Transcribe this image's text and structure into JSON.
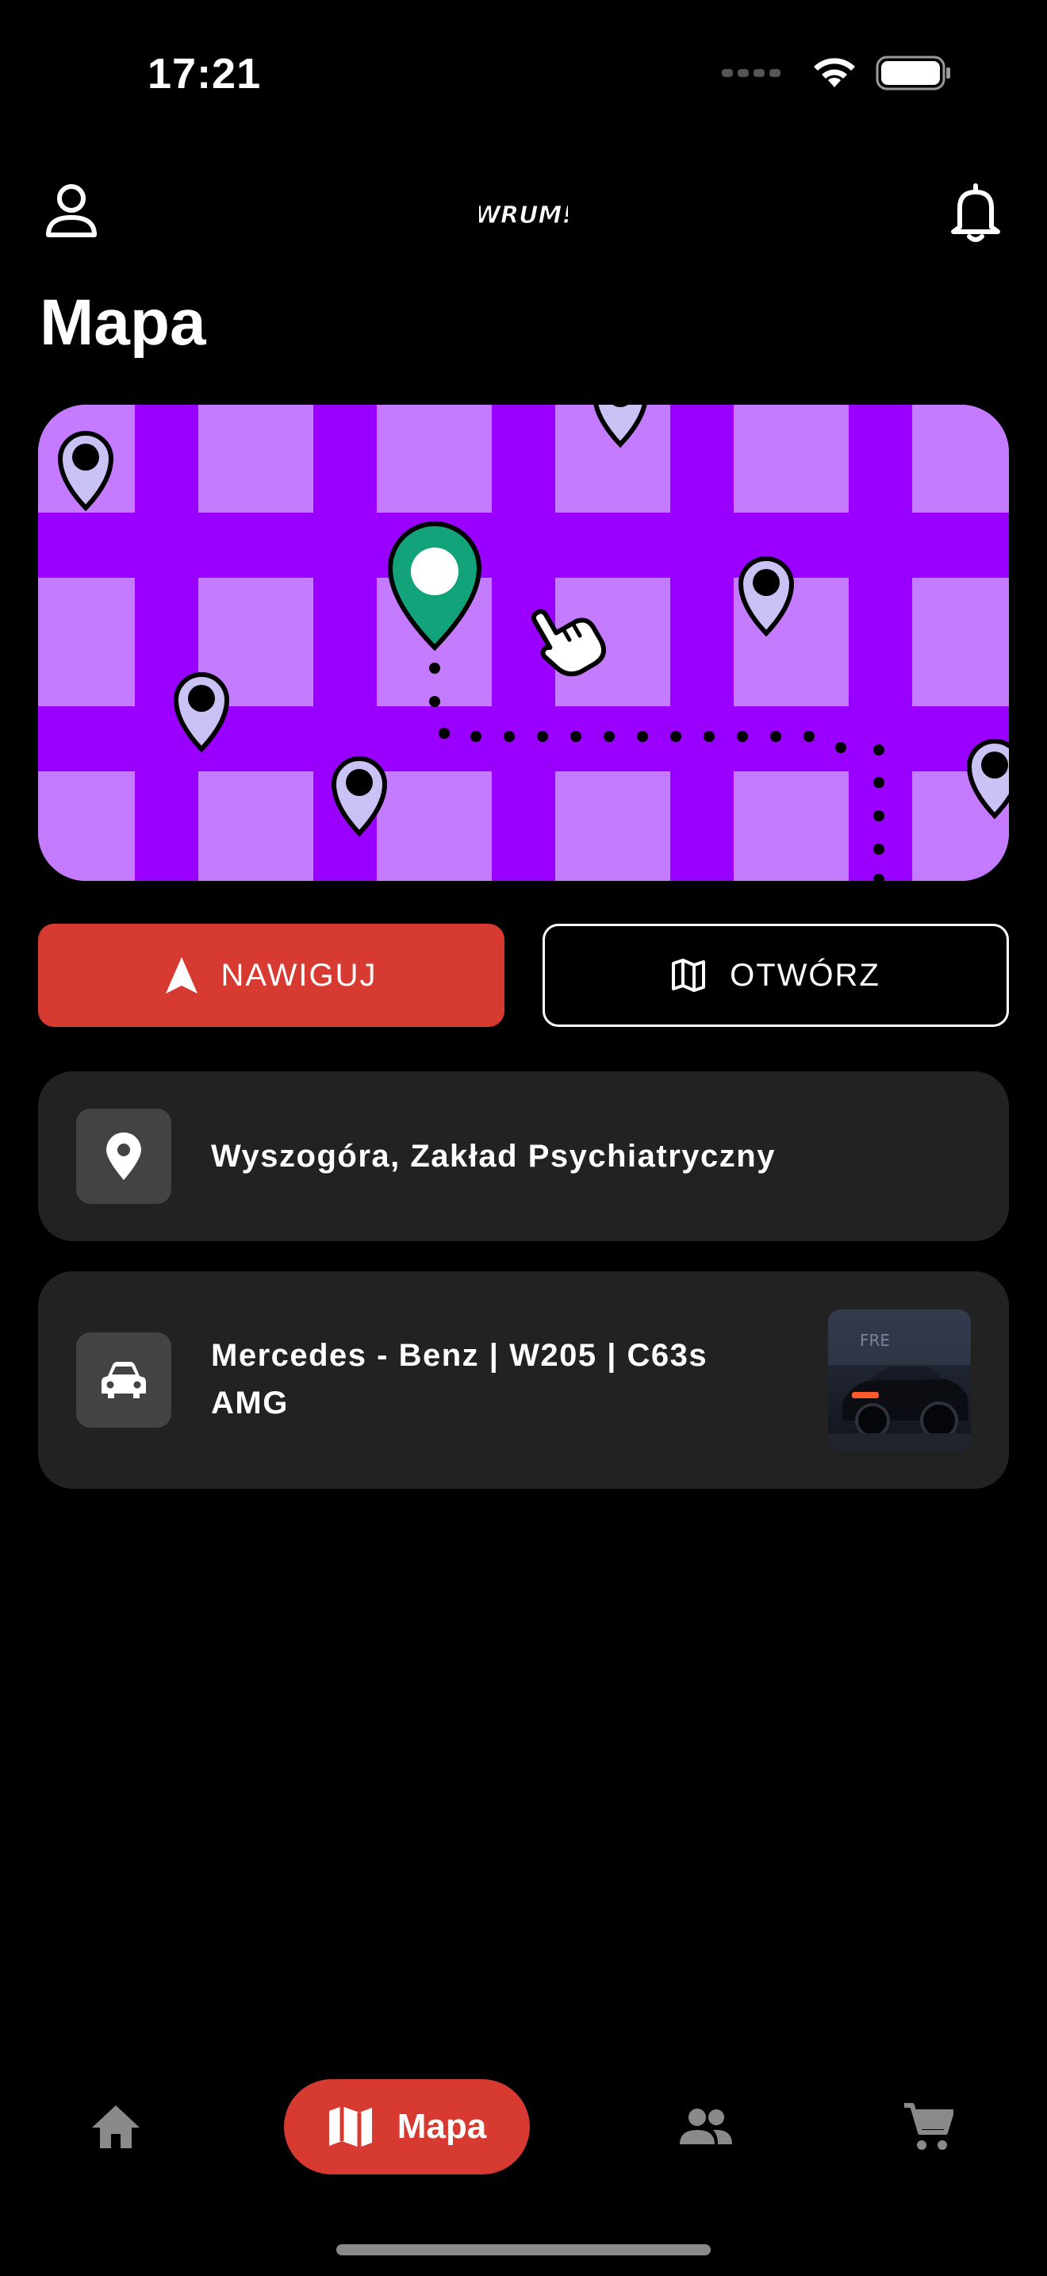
{
  "status_bar": {
    "time": "17:21"
  },
  "header": {
    "profile_icon": "person-outline-icon",
    "notifications_icon": "bell-outline-icon",
    "logo_text": "WRUM!"
  },
  "page": {
    "title": "Mapa"
  },
  "map": {
    "colors": {
      "block": "#c57bff",
      "road": "#9900ff",
      "active_pin": "#12a37a",
      "pin": "#c9c3f5"
    }
  },
  "actions": {
    "navigate_label": "NAWIGUJ",
    "navigate_icon": "navigation-arrow-icon",
    "open_label": "OTWÓRZ",
    "open_icon": "map-outline-icon"
  },
  "location_card": {
    "icon": "location-pin-icon",
    "text": "Wyszogóra, Zakład Psychiatryczny"
  },
  "car_card": {
    "icon": "car-icon",
    "line1": "Mercedes - Benz | W205 | C63s",
    "line2": "AMG"
  },
  "bottom_nav": {
    "items": [
      {
        "icon": "home-icon",
        "label": ""
      },
      {
        "icon": "map-icon",
        "label": "Mapa",
        "active": true
      },
      {
        "icon": "people-icon",
        "label": ""
      },
      {
        "icon": "cart-icon",
        "label": ""
      }
    ]
  },
  "colors": {
    "accent": "#d63a30",
    "card": "#222222",
    "icon_box": "#434343",
    "nav_inactive": "#8a8a8a"
  }
}
